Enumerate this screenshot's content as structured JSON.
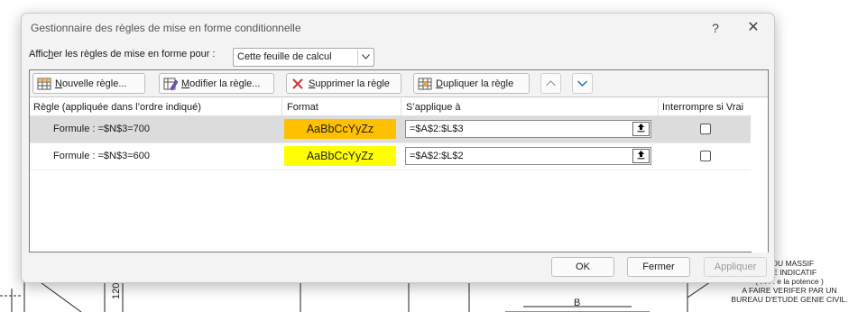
{
  "dialog": {
    "title": "Gestionnaire des règles de mise en forme conditionnelle",
    "help_glyph": "?",
    "close_glyph": "✕"
  },
  "show_rules": {
    "label_prefix": "Affic",
    "label_accel": "h",
    "label_suffix": "er les règles de mise en forme pour :",
    "selected": "Cette feuille de calcul"
  },
  "toolbar": {
    "new_accel": "N",
    "new_rest": "ouvelle règle...",
    "edit_accel": "M",
    "edit_rest": "odifier la règle...",
    "delete_accel": "S",
    "delete_rest": "upprimer la règle",
    "duplicate_accel": "D",
    "duplicate_rest": "upliquer la règle",
    "up_glyph": "∧",
    "down_glyph": "∨"
  },
  "columns": {
    "rule": "Règle (appliquée dans l’ordre indiqué)",
    "format": "Format",
    "applies": "S’applique à",
    "stop": "Interrompre si Vrai"
  },
  "rules": [
    {
      "rule": "Formule : =$N$3=700",
      "format_preview": "AaBbCcYyZz",
      "format_color": "#ffc000",
      "applies_to": "=$A$2:$L$3",
      "stop_if_true": false,
      "selected": true
    },
    {
      "rule": "Formule : =$N$3=600",
      "format_preview": "AaBbCcYyZz",
      "format_color": "#ffff00",
      "applies_to": "=$A$2:$L$2",
      "stop_if_true": false,
      "selected": false
    }
  ],
  "buttons": {
    "ok": "OK",
    "close": "Fermer",
    "apply": "Appliquer"
  },
  "background": {
    "dim_label_left": "120",
    "dim_label_b": "B",
    "note_lines": [
      "S DU MASSIF",
      "TRE INDICATIF",
      "( . . . . e la potence )",
      "A FAIRE VERIFER PAR UN",
      "BUREAU D'ETUDE GENIE CIVIL."
    ]
  }
}
